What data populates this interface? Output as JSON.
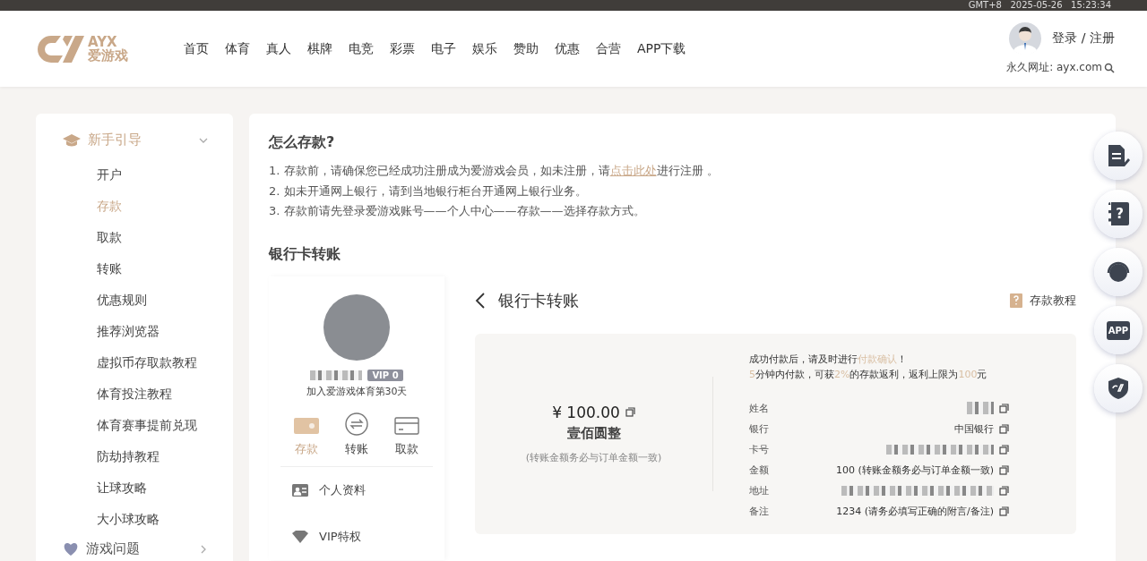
{
  "top_bar": {
    "clock": "GMT+8   2025-05-26   15:23:34"
  },
  "header": {
    "logo": {
      "brand": "AYX",
      "name": "爱游戏"
    },
    "nav": [
      "首页",
      "体育",
      "真人",
      "棋牌",
      "电竞",
      "彩票",
      "电子",
      "娱乐",
      "赞助",
      "优惠",
      "合营",
      "APP下载"
    ],
    "login": "登录 / 注册",
    "site_url": "永久网址: ayx.com"
  },
  "sidebar": {
    "groups": [
      {
        "title": "新手引导",
        "expanded": true,
        "items": [
          {
            "label": "开户",
            "selected": false
          },
          {
            "label": "存款",
            "selected": true
          },
          {
            "label": "取款",
            "selected": false
          },
          {
            "label": "转账",
            "selected": false
          },
          {
            "label": "优惠规则",
            "selected": false
          },
          {
            "label": "推荐浏览器",
            "selected": false
          },
          {
            "label": "虚拟币存取款教程",
            "selected": false
          },
          {
            "label": "体育投注教程",
            "selected": false
          },
          {
            "label": "体育赛事提前兑现",
            "selected": false
          },
          {
            "label": "防劫持教程",
            "selected": false
          },
          {
            "label": "让球攻略",
            "selected": false
          },
          {
            "label": "大小球攻略",
            "selected": false
          }
        ]
      },
      {
        "title": "游戏问题",
        "expanded": false
      }
    ]
  },
  "article": {
    "title": "怎么存款?",
    "steps": [
      {
        "before": "1. 存款前，请确保您已经成功注册成为爱游戏会员，如未注册，请",
        "link": "点击此处",
        "after": "进行注册 。"
      },
      {
        "before": "2. 如未开通网上银行，请到当地银行柜台开通网上银行业务。"
      },
      {
        "before": "3. 存款前请先登录爱游戏账号——个人中心——存款——选择存款方式。"
      }
    ],
    "section_title": "银行卡转账"
  },
  "profile": {
    "vip": "VIP 0",
    "joined": "加入爱游戏体育第30天",
    "actions": [
      {
        "kind": "deposit",
        "label": "存款",
        "selected": true
      },
      {
        "kind": "transfer",
        "label": "转账",
        "selected": false
      },
      {
        "kind": "withdraw",
        "label": "取款",
        "selected": false
      }
    ],
    "menu": [
      {
        "kind": "id",
        "label": "个人资料"
      },
      {
        "kind": "vip",
        "label": "VIP特权"
      }
    ]
  },
  "payment": {
    "title": "银行卡转账",
    "tutorial": "存款教程",
    "amount": "¥ 100.00",
    "amount_words": "壹佰圆整",
    "amount_note": "(转账金额务必与订单金额一致)",
    "notice": [
      "成功付款后，请及时进行**付款确认**！",
      "**5**分钟内付款，可获**2%**的存款返利，返利上限为**100**元"
    ],
    "fields": [
      {
        "label": "姓名",
        "kind": "redacted"
      },
      {
        "label": "银行",
        "kind": "text",
        "value": "中国银行"
      },
      {
        "label": "卡号",
        "kind": "redacted"
      },
      {
        "label": "金额",
        "kind": "text",
        "value": "100 (转账金额务必与订单金额一致)"
      },
      {
        "label": "地址",
        "kind": "redacted"
      },
      {
        "label": "备注",
        "kind": "text",
        "value": "1234 (请务必填写正确的附言/备注)"
      }
    ]
  },
  "float_buttons": [
    {
      "kind": "form"
    },
    {
      "kind": "help",
      "label": "?"
    },
    {
      "kind": "support"
    },
    {
      "kind": "app",
      "label": "APP"
    },
    {
      "kind": "logo"
    }
  ]
}
